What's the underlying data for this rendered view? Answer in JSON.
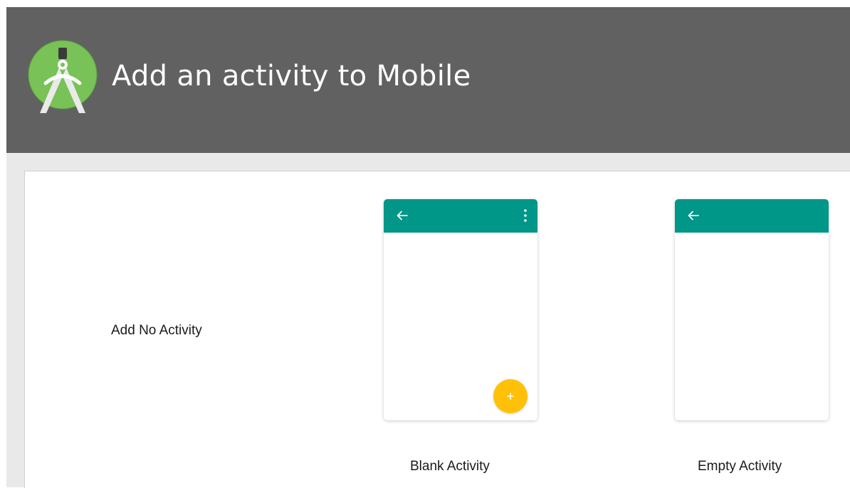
{
  "header": {
    "title": "Add an activity to Mobile",
    "logo_icon": "android-studio-logo-icon",
    "background_color": "#616161"
  },
  "gallery": {
    "no_activity_label": "Add No Activity",
    "templates": [
      {
        "label": "Blank Activity",
        "icons": [
          "back-arrow-icon",
          "overflow-menu-icon",
          "add-fab-icon"
        ]
      },
      {
        "label": "Empty Activity",
        "icons": [
          "back-arrow-icon"
        ]
      }
    ]
  },
  "colors": {
    "appbar": "#009688",
    "fab": "#ffc107",
    "logo_green": "#78c257",
    "content_background": "#e9e9e9"
  }
}
